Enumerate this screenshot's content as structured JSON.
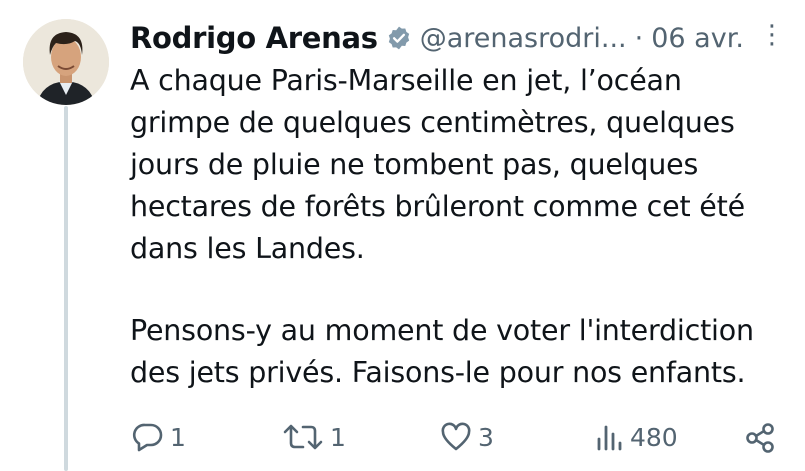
{
  "tweet": {
    "author_name": "Rodrigo Arenas",
    "handle": "@arenasrodri...",
    "separator": "·",
    "date": "06 avr.",
    "more_label": "⋮",
    "paragraphs": [
      "A chaque Paris-Marseille en jet, l’océan grimpe de quelques centimètres, quelques jours de pluie ne tombent pas, quelques hectares de forêts brûleront comme cet été dans les Landes.",
      "Pensons-y au moment de voter l'interdiction des jets privés. Faisons-le pour nos enfants."
    ],
    "actions": {
      "replies": "1",
      "retweets": "1",
      "likes": "3",
      "views": "480"
    }
  },
  "colors": {
    "text": "#0f1419",
    "secondary": "#536471",
    "badge": "#829aab",
    "thread_line": "#cfd9de"
  },
  "icons": [
    "verified-badge-icon",
    "more-icon",
    "reply-icon",
    "retweet-icon",
    "like-icon",
    "views-icon",
    "share-icon"
  ]
}
